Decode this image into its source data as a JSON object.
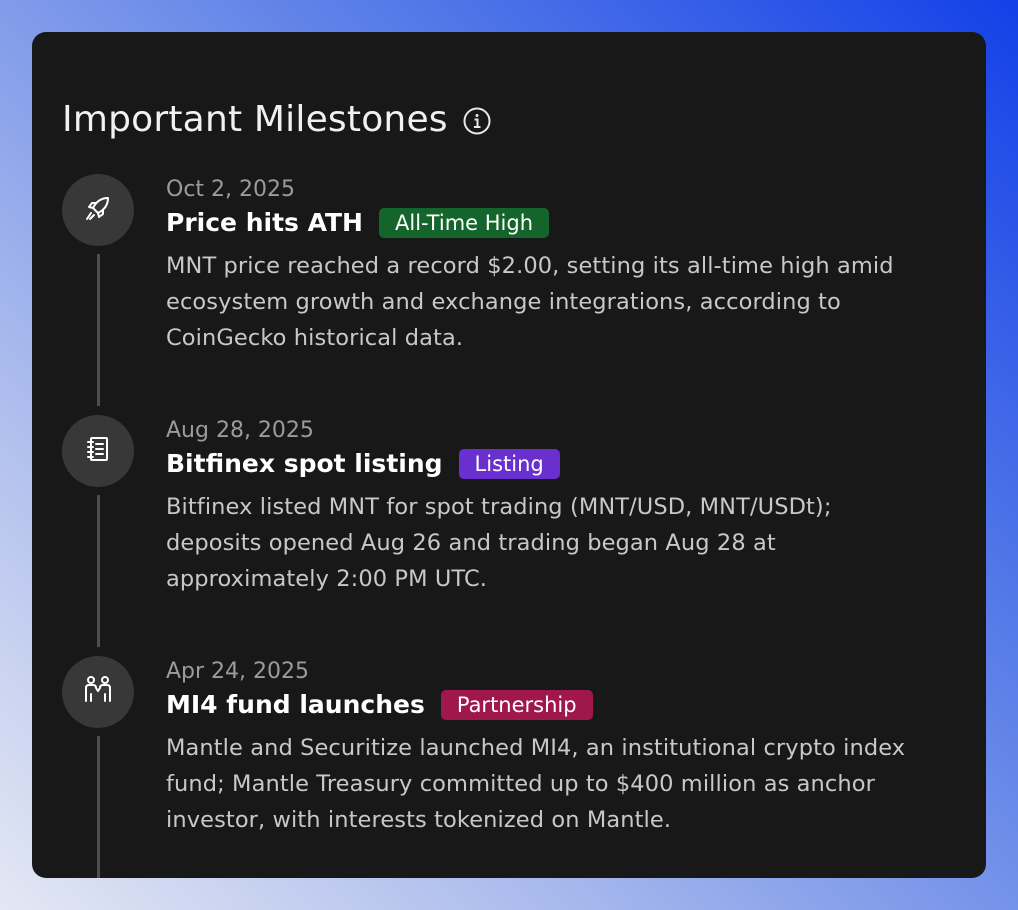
{
  "header": {
    "title": "Important Milestones",
    "info_icon": "info-circle-icon"
  },
  "milestones": [
    {
      "icon": "rocket-icon",
      "date": "Oct 2, 2025",
      "title": "Price hits ATH",
      "badge": "All-Time High",
      "badge_color": "#14652b",
      "description": "MNT price reached a record $2.00, setting its all-time high amid ecosystem growth and exchange integrations, according to CoinGecko historical data."
    },
    {
      "icon": "notebook-icon",
      "date": "Aug 28, 2025",
      "title": "Bitfinex spot listing",
      "badge": "Listing",
      "badge_color": "#6a2fcf",
      "description": "Bitfinex listed MNT for spot trading (MNT/USD, MNT/USDt); deposits opened Aug 26 and trading began Aug 28 at approximately 2:00 PM UTC."
    },
    {
      "icon": "partnership-people-icon",
      "date": "Apr 24, 2025",
      "title": "MI4 fund launches",
      "badge": "Partnership",
      "badge_color": "#a0174e",
      "description": "Mantle and Securitize launched MI4, an institutional crypto index fund; Mantle Treasury committed up to $400 million as anchor investor, with interests tokenized on Mantle."
    }
  ],
  "colors": {
    "card_background": "#181818",
    "node_background": "#383838",
    "connector": "#4e4e4e"
  }
}
